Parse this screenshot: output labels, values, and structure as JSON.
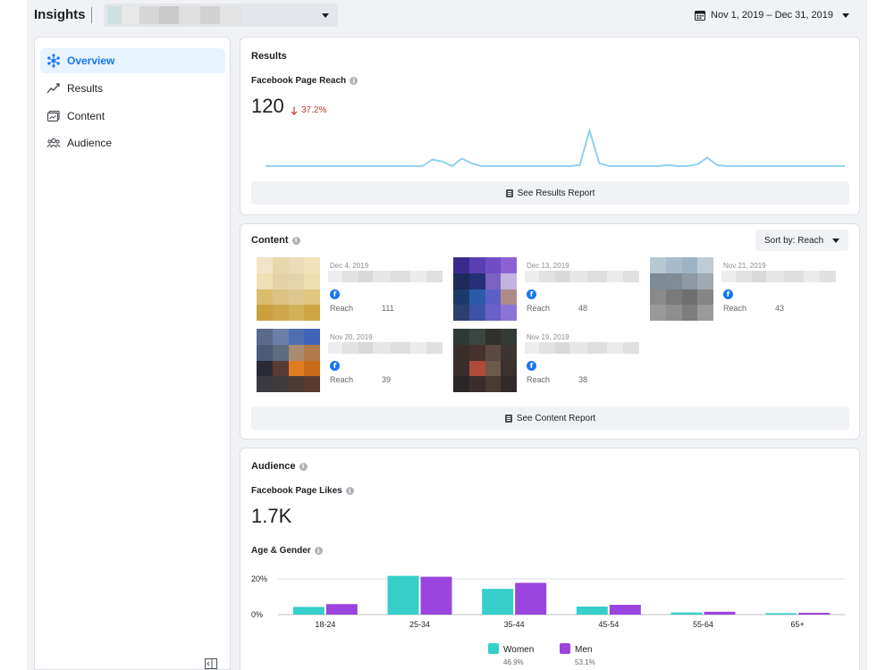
{
  "header": {
    "app_title": "Insights",
    "date_range": "Nov 1, 2019 – Dec 31, 2019"
  },
  "sidebar": {
    "items": [
      {
        "label": "Overview",
        "icon": "overview-icon",
        "active": true
      },
      {
        "label": "Results",
        "icon": "trend-icon",
        "active": false
      },
      {
        "label": "Content",
        "icon": "content-icon",
        "active": false
      },
      {
        "label": "Audience",
        "icon": "audience-icon",
        "active": false
      }
    ]
  },
  "results": {
    "title": "Results",
    "metric_label": "Facebook Page Reach",
    "value": "120",
    "delta": "37.2%",
    "delta_direction": "down",
    "report_button": "See Results Report",
    "sparkline": [
      2,
      2,
      2,
      2,
      2,
      2,
      2,
      2,
      2,
      2,
      2,
      2,
      2,
      2,
      2,
      2,
      2,
      2,
      2,
      2,
      2,
      2,
      2,
      2,
      2,
      2,
      2,
      2,
      2,
      2,
      2,
      2,
      2,
      2,
      2,
      2,
      2,
      2,
      2,
      2,
      2,
      2,
      2,
      2,
      2,
      2,
      2,
      2,
      2,
      2,
      2,
      2,
      2,
      2,
      2,
      2,
      2,
      2,
      2,
      2
    ]
  },
  "content": {
    "title": "Content",
    "sort_label": "Sort by: Reach",
    "report_button": "See Content Report",
    "posts": [
      {
        "date": "Dec 4, 2019",
        "metric": "Reach",
        "value": "111",
        "thumb": [
          "#f1e4c6",
          "#e9d6ad",
          "#eadcb8",
          "#f2e2bb",
          "#efe0b5",
          "#e6d2a6",
          "#e5d4aa",
          "#f0dfae",
          "#d9bc6c",
          "#dcc385",
          "#dcc791",
          "#e0c77d",
          "#c9a13f",
          "#cfa84e",
          "#d3b159",
          "#cea646"
        ]
      },
      {
        "date": "Dec 13, 2019",
        "metric": "Reach",
        "value": "48",
        "thumb": [
          "#3b2a8c",
          "#5a3fb2",
          "#6e4dc6",
          "#8a62d4",
          "#1d2a5c",
          "#26307a",
          "#7b62c0",
          "#c2b3e0",
          "#1b3a6b",
          "#2a5aa8",
          "#5d5fc9",
          "#b08a8a",
          "#2b3f70",
          "#3d52a6",
          "#6a60c8",
          "#8a74d6"
        ]
      },
      {
        "date": "Nov 21, 2019",
        "metric": "Reach",
        "value": "43",
        "thumb": [
          "#b7c8d3",
          "#a9bccb",
          "#9eb3c4",
          "#c0ccd5",
          "#7e8a94",
          "#7f8b95",
          "#8e99a3",
          "#a0a9b1",
          "#8a8a8a",
          "#7a7a7a",
          "#6f6f6f",
          "#858585",
          "#999999",
          "#8f8f8f",
          "#7d7d7d",
          "#9a9a9a"
        ]
      },
      {
        "date": "Nov 20, 2019",
        "metric": "Reach",
        "value": "39",
        "thumb": [
          "#5a6a8a",
          "#6a7fa8",
          "#4e6fb0",
          "#3f64b8",
          "#4a5a78",
          "#5f6c7e",
          "#a88a70",
          "#b07a4a",
          "#2a2a34",
          "#5a3a34",
          "#e07a20",
          "#c86a1a",
          "#3a3a40",
          "#3f3a3c",
          "#4a3a34",
          "#5a3a2c"
        ]
      },
      {
        "date": "Nov 19, 2019",
        "metric": "Reach",
        "value": "38",
        "thumb": [
          "#2e3a38",
          "#3a4642",
          "#30302c",
          "#343a36",
          "#3a2e2c",
          "#45322e",
          "#5a4a42",
          "#3c3430",
          "#3a2c2a",
          "#b04a3a",
          "#6e5a4a",
          "#3a302c",
          "#2a2626",
          "#3a2e2c",
          "#4a3a34",
          "#302a28"
        ]
      }
    ]
  },
  "audience": {
    "title": "Audience",
    "metric_label": "Facebook Page Likes",
    "value": "1.7K",
    "chart_title": "Age & Gender"
  },
  "chart_data": {
    "type": "bar",
    "title": "Age & Gender",
    "categories": [
      "18-24",
      "25-34",
      "35-44",
      "45-54",
      "55-64",
      "65+"
    ],
    "series": [
      {
        "name": "Women",
        "color": "#36cfc9",
        "percent_label": "46.9%",
        "values": [
          4.3,
          21.7,
          14.4,
          4.5,
          1.2,
          0.8
        ]
      },
      {
        "name": "Men",
        "color": "#9b45df",
        "percent_label": "53.1%",
        "values": [
          5.9,
          21.2,
          17.8,
          5.5,
          1.6,
          1.0
        ]
      }
    ],
    "y_ticks": [
      "0%",
      "20%"
    ],
    "ylim": [
      0,
      25
    ],
    "grid": true,
    "legend": "bottom"
  }
}
